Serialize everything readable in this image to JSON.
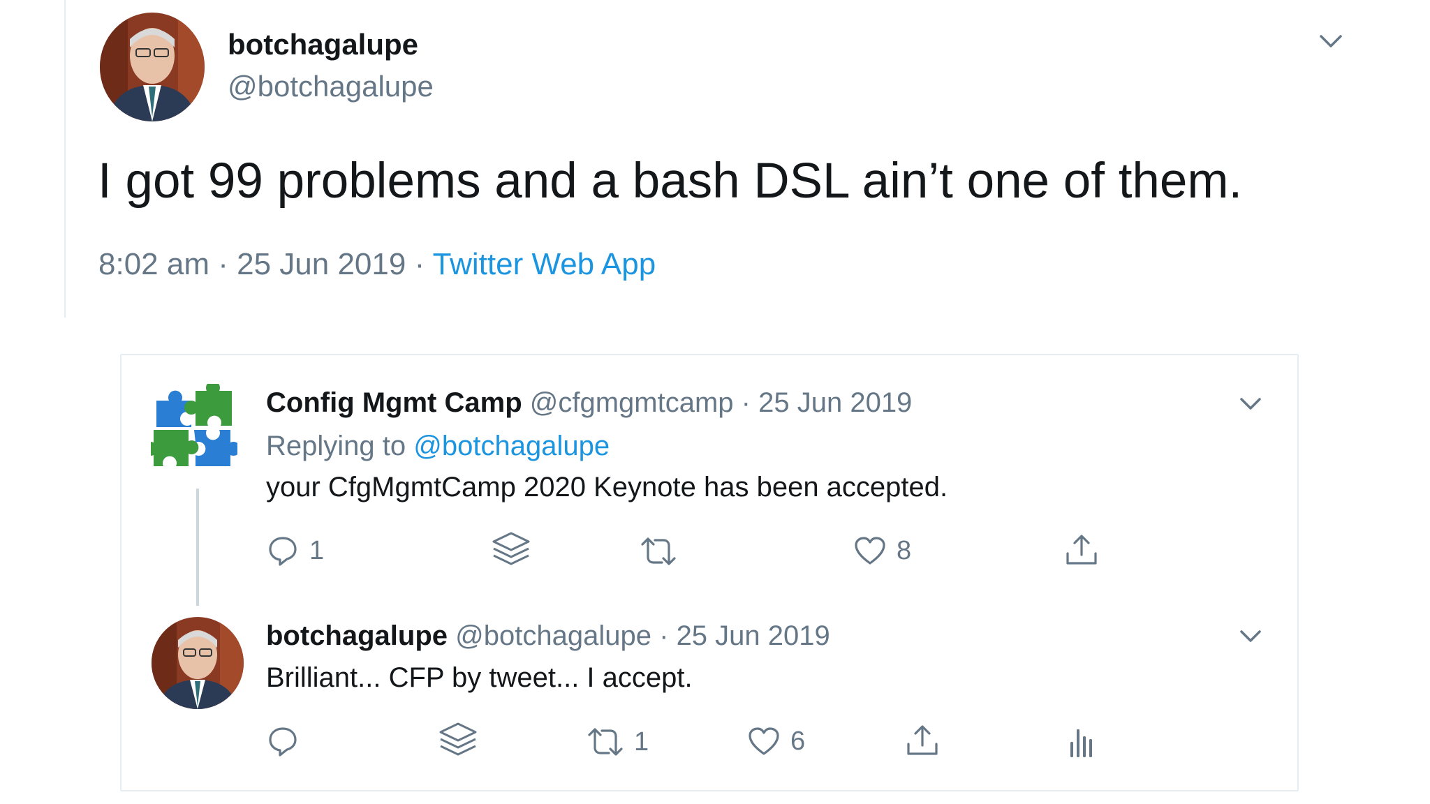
{
  "main_tweet": {
    "display_name": "botchagalupe",
    "handle": "@botchagalupe",
    "text": "I got 99 problems and a bash DSL ain’t one of them.",
    "time": "8:02 am",
    "separator": "·",
    "date": "25 Jun 2019",
    "source": "Twitter Web App"
  },
  "replies": [
    {
      "display_name": "Config Mgmt Camp",
      "handle": "@cfgmgmtcamp",
      "separator": "·",
      "date": "25 Jun 2019",
      "replying_prefix": "Replying to",
      "replying_to": "@botchagalupe",
      "text": "your CfgMgmtCamp 2020 Keynote has been accepted.",
      "reply_count": "1",
      "like_count": "8"
    },
    {
      "display_name": "botchagalupe",
      "handle": "@botchagalupe",
      "separator": "·",
      "date": "25 Jun 2019",
      "text": "Brilliant... CFP by tweet... I accept.",
      "retweet_count": "1",
      "like_count": "6"
    }
  ],
  "icons": {
    "more": "chevron-down-icon",
    "reply": "reply-icon",
    "stack": "layers-icon",
    "retweet": "retweet-icon",
    "like": "heart-icon",
    "share": "share-icon",
    "analytics": "analytics-icon"
  },
  "colors": {
    "link": "#1b95e0",
    "muted": "#657786",
    "text": "#14171a",
    "logo_blue": "#2a7fd4",
    "logo_green": "#3c9b3c"
  }
}
